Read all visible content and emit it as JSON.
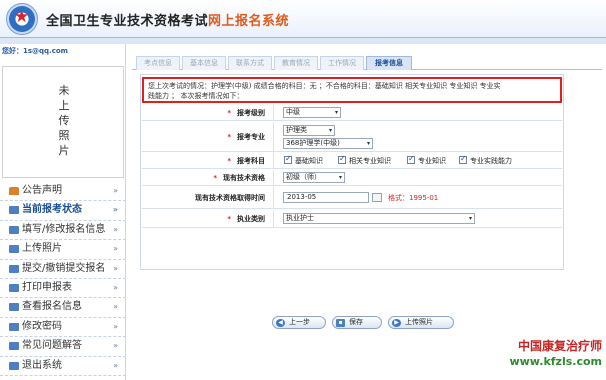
{
  "header": {
    "title_main": "全国卫生专业技术资格考试",
    "title_accent": "网上报名系统"
  },
  "sidebar": {
    "greeting": "您好：1s@qq.com",
    "photo_placeholder": "未上传照片",
    "menu": [
      {
        "label": "公告声明",
        "icon": "home-icon",
        "active": false
      },
      {
        "label": "当前报考状态",
        "icon": "status-icon",
        "active": true
      },
      {
        "label": "填写/修改报名信息",
        "icon": "edit-icon",
        "active": false
      },
      {
        "label": "上传照片",
        "icon": "upload-icon",
        "active": false
      },
      {
        "label": "提交/撤销提交报名",
        "icon": "submit-icon",
        "active": false
      },
      {
        "label": "打印申报表",
        "icon": "print-icon",
        "active": false
      },
      {
        "label": "查看报名信息",
        "icon": "view-icon",
        "active": false
      },
      {
        "label": "修改密码",
        "icon": "key-icon",
        "active": false
      },
      {
        "label": "常见问题解答",
        "icon": "faq-icon",
        "active": false
      },
      {
        "label": "退出系统",
        "icon": "exit-icon",
        "active": false
      }
    ],
    "arrow": "»"
  },
  "tabs": [
    {
      "label": "考点信息",
      "active": false
    },
    {
      "label": "基本信息",
      "active": false
    },
    {
      "label": "联系方式",
      "active": false
    },
    {
      "label": "教育情况",
      "active": false
    },
    {
      "label": "工作情况",
      "active": false
    },
    {
      "label": "报考信息",
      "active": true
    }
  ],
  "form": {
    "notice_line1": "您上次考试的情况：护理学(中级) 成绩合格的科目：无 ；不合格的科目：基础知识 相关专业知识 专业知识 专业实",
    "notice_line2": "践能力 ； 本次报考情况如下：",
    "level_label": "报考级别",
    "level_value": "中级",
    "major_label": "报考专业",
    "major_category": "护理类",
    "major_value": "368护理学(中级)",
    "subjects_label": "报考科目",
    "subjects": [
      "基础知识",
      "相关专业知识",
      "专业知识",
      "专业实践能力"
    ],
    "current_title_label": "现有技术资格",
    "current_title_value": "初级（师）",
    "obtain_date_label": "现有技术资格取得时间",
    "obtain_date_value": "2013-05",
    "format_hint": "格式：1995-01",
    "practice_label": "执业类别",
    "practice_value": "执业护士",
    "caret": "▾"
  },
  "buttons": {
    "prev": "上一步",
    "save": "保存",
    "upload": "上传照片"
  },
  "watermark": {
    "name": "中国康复治疗师",
    "url": "www.kfzls.com"
  },
  "colors": {
    "accent": "#e05a1b",
    "highlight_border": "#e02020",
    "link_blue": "#1d4f96"
  }
}
